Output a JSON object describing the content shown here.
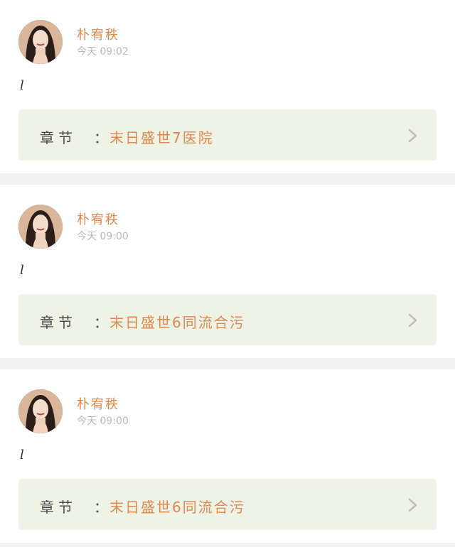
{
  "posts": [
    {
      "user_name": "朴宥秩",
      "time": "今天 09:02",
      "content": "l",
      "chapter_prefix": "章节",
      "chapter_colon": "：",
      "chapter_title": "末日盛世7医院"
    },
    {
      "user_name": "朴宥秩",
      "time": "今天 09:00",
      "content": "l",
      "chapter_prefix": "章节",
      "chapter_colon": "：",
      "chapter_title": "末日盛世6同流合污"
    },
    {
      "user_name": "朴宥秩",
      "time": "今天 09:00",
      "content": "l",
      "chapter_prefix": "章节",
      "chapter_colon": "：",
      "chapter_title": "末日盛世6同流合污"
    }
  ],
  "colors": {
    "accent": "#e0884f",
    "card_bg": "#eef3e6",
    "time": "#b8b8b8",
    "page_bg": "#f2f2f2"
  },
  "icons": {
    "chevron": "chevron-right-icon",
    "avatar": "user-avatar"
  }
}
